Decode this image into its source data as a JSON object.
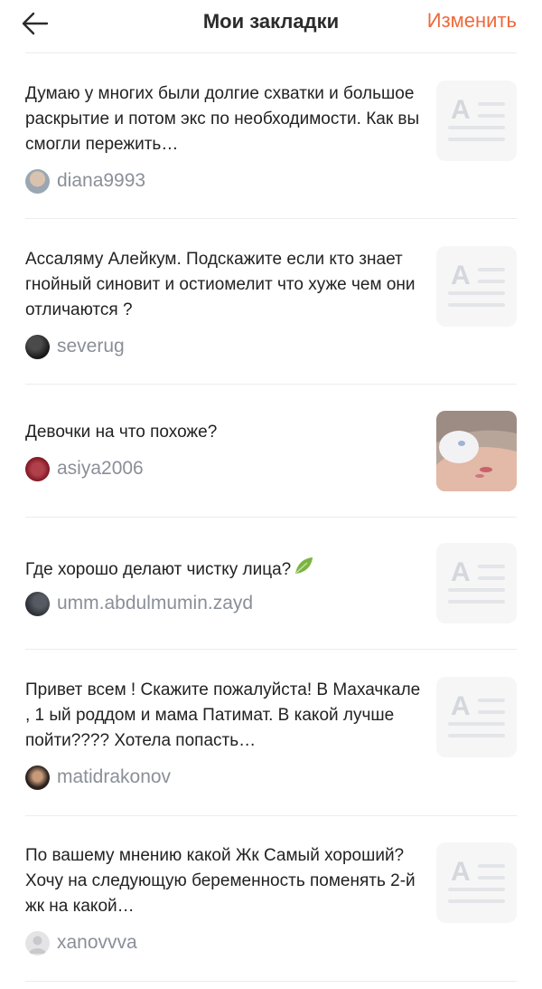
{
  "header": {
    "title": "Мои закладки",
    "edit_label": "Изменить"
  },
  "colors": {
    "accent": "#ee6a3c",
    "author": "#8a8f98",
    "divider": "#ececec"
  },
  "items": [
    {
      "text": "Думаю у многих были долгие схватки и большое раскрытие и потом экс по необходимости. Как вы смогли пережить…",
      "author": "diana9993",
      "thumb": "text-placeholder-icon"
    },
    {
      "text": "Ассаляму Алейкум. Подскажите если кто знает гнойный синовит  и остиомелит что хуже чем они отличаются ?",
      "author": "severug",
      "thumb": "text-placeholder-icon"
    },
    {
      "text": "Девочки на что похоже?",
      "author": "asiya2006",
      "thumb": "photo"
    },
    {
      "text": "Где хорошо делают чистку лица?",
      "author": "umm.abdulmumin.zayd",
      "thumb": "text-placeholder-icon"
    },
    {
      "text": "Привет всем ! Скажите пожалуйста! В Махачкале , 1 ый роддом и мама Патимат. В какой лучше пойти???? Хотела попасть…",
      "author": "matidrakonov",
      "thumb": "text-placeholder-icon"
    },
    {
      "text": "По вашему мнению какой Жк Самый хороший?  Хочу на следующую беременность поменять 2-й жк на какой…",
      "author": "xanovvva",
      "thumb": "text-placeholder-icon"
    }
  ]
}
